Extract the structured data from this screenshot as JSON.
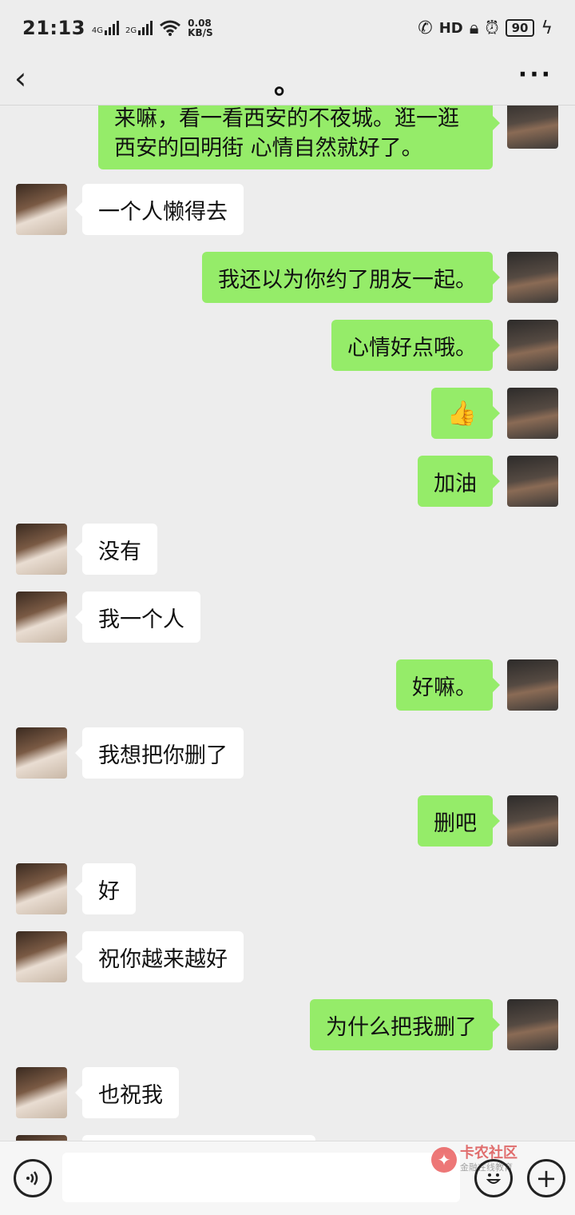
{
  "status_bar": {
    "time": "21:13",
    "signal1": "4G",
    "signal2": "2G",
    "net_speed_value": "0.08",
    "net_speed_unit": "KB/S",
    "hd_label": "HD",
    "battery": "90"
  },
  "header": {
    "title": "。",
    "back_icon": "chevron-left-icon",
    "more_icon": "more-icon"
  },
  "messages": [
    {
      "side": "right",
      "text": "来嘛，看一看西安的不夜城。逛一逛西安的回明街 心情自然就好了。"
    },
    {
      "side": "left",
      "text": "一个人懒得去"
    },
    {
      "side": "right",
      "text": "我还以为你约了朋友一起。"
    },
    {
      "side": "right",
      "text": "心情好点哦。"
    },
    {
      "side": "right",
      "text": "👍"
    },
    {
      "side": "right",
      "text": "加油"
    },
    {
      "side": "left",
      "text": "没有"
    },
    {
      "side": "left",
      "text": "我一个人"
    },
    {
      "side": "right",
      "text": "好嘛。"
    },
    {
      "side": "left",
      "text": "我想把你删了"
    },
    {
      "side": "right",
      "text": "删吧"
    },
    {
      "side": "left",
      "text": "好"
    },
    {
      "side": "left",
      "text": "祝你越来越好"
    },
    {
      "side": "right",
      "text": "为什么把我删了"
    },
    {
      "side": "left",
      "text": "也祝我"
    }
  ],
  "input_bar": {
    "voice_icon": "voice-icon",
    "emoji_icon": "emoji-icon",
    "plus_icon": "plus-icon"
  },
  "watermark": {
    "title": "卡农社区",
    "subtitle": "金融在线教育"
  }
}
